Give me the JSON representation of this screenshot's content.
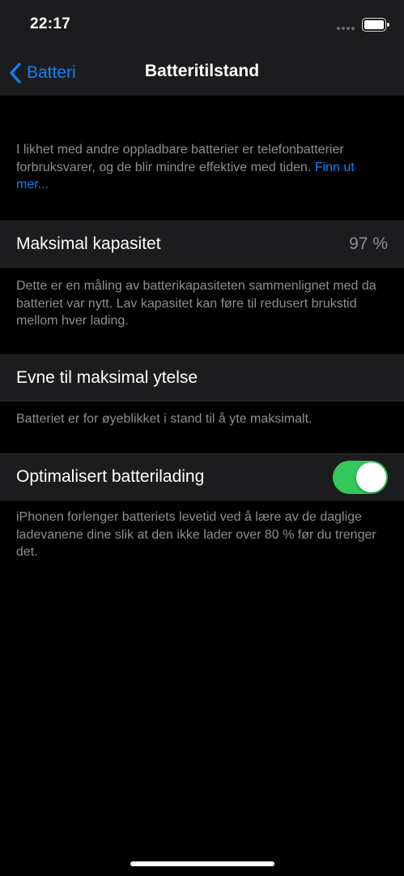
{
  "status_bar": {
    "time": "22:17",
    "icons": [
      "signal-dots-icon",
      "battery-icon"
    ]
  },
  "nav": {
    "back_label": "Batteri",
    "title": "Batteritilstand"
  },
  "intro": {
    "text": "I likhet med andre oppladbare batterier er telefonbatterier forbruksvarer, og de blir mindre effektive med tiden. ",
    "link": "Finn ut mer..."
  },
  "max_capacity": {
    "label": "Maksimal kapasitet",
    "value": "97 %",
    "footer": "Dette er en måling av batterikapasiteten sammenlignet med da batteriet var nytt. Lav kapasitet kan føre til redusert brukstid mellom hver lading."
  },
  "peak_performance": {
    "label": "Evne til maksimal ytelse",
    "footer": "Batteriet er for øyeblikket i stand til å yte maksimalt."
  },
  "optimized_charging": {
    "label": "Optimalisert batterilading",
    "enabled": true,
    "footer": "iPhonen forlenger batteriets levetid ved å lære av de daglige ladevanene dine slik at den ikke lader over 80 % før du trenger det."
  },
  "colors": {
    "background": "#000000",
    "cell_background": "#1c1c1e",
    "accent": "#0a84ff",
    "toggle_on": "#34c759",
    "secondary_text": "#8e8e93"
  }
}
